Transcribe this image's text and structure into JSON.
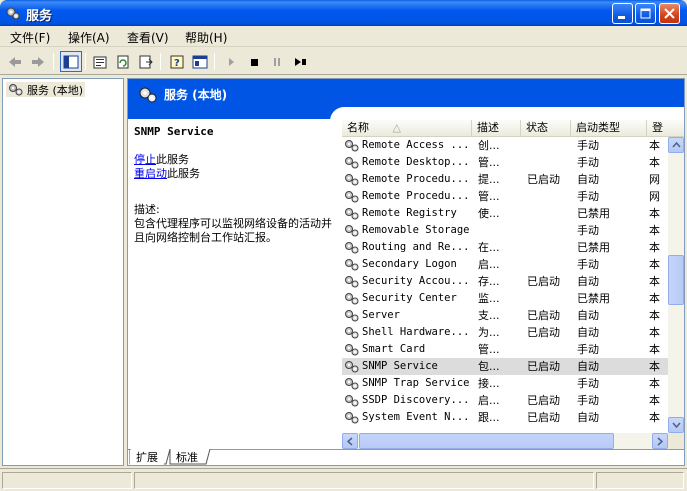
{
  "window": {
    "title": "服务",
    "icon": "gear-icon"
  },
  "menu": [
    "文件(F)",
    "操作(A)",
    "查看(V)",
    "帮助(H)"
  ],
  "toolbar": {
    "icons": [
      "back-icon",
      "forward-icon",
      "show-hide-tree-icon",
      "properties-icon",
      "refresh-icon",
      "export-list-icon",
      "help-icon",
      "console-icon",
      "start-service-icon",
      "stop-service-icon",
      "pause-service-icon",
      "restart-service-icon"
    ]
  },
  "tree": {
    "root_label": "服务 (本地)"
  },
  "pane": {
    "header_title": "服务 (本地)",
    "selected_service": "SNMP Service",
    "stop_link": "停止",
    "stop_suffix": "此服务",
    "restart_link": "重启动",
    "restart_suffix": "此服务",
    "desc_label": "描述:",
    "desc_text": "包含代理程序可以监视网络设备的活动并且向网络控制台工作站汇报。"
  },
  "list": {
    "columns": [
      "名称",
      "描述",
      "状态",
      "启动类型",
      "登"
    ],
    "rows": [
      {
        "name": "Remote Access ...",
        "desc": "创...",
        "status": "",
        "start": "手动",
        "logon": "本"
      },
      {
        "name": "Remote Desktop...",
        "desc": "管...",
        "status": "",
        "start": "手动",
        "logon": "本"
      },
      {
        "name": "Remote Procedu...",
        "desc": "提...",
        "status": "已启动",
        "start": "自动",
        "logon": "网"
      },
      {
        "name": "Remote Procedu...",
        "desc": "管...",
        "status": "",
        "start": "手动",
        "logon": "网"
      },
      {
        "name": "Remote Registry",
        "desc": "使...",
        "status": "",
        "start": "已禁用",
        "logon": "本"
      },
      {
        "name": "Removable Storage",
        "desc": "",
        "status": "",
        "start": "手动",
        "logon": "本"
      },
      {
        "name": "Routing and Re...",
        "desc": "在...",
        "status": "",
        "start": "已禁用",
        "logon": "本"
      },
      {
        "name": "Secondary Logon",
        "desc": "启...",
        "status": "",
        "start": "手动",
        "logon": "本"
      },
      {
        "name": "Security Accou...",
        "desc": "存...",
        "status": "已启动",
        "start": "自动",
        "logon": "本"
      },
      {
        "name": "Security Center",
        "desc": "监...",
        "status": "",
        "start": "已禁用",
        "logon": "本"
      },
      {
        "name": "Server",
        "desc": "支...",
        "status": "已启动",
        "start": "自动",
        "logon": "本"
      },
      {
        "name": "Shell Hardware...",
        "desc": "为...",
        "status": "已启动",
        "start": "自动",
        "logon": "本"
      },
      {
        "name": "Smart Card",
        "desc": "管...",
        "status": "",
        "start": "手动",
        "logon": "本"
      },
      {
        "name": "SNMP Service",
        "desc": "包...",
        "status": "已启动",
        "start": "自动",
        "logon": "本"
      },
      {
        "name": "SNMP Trap Service",
        "desc": "接...",
        "status": "",
        "start": "手动",
        "logon": "本"
      },
      {
        "name": "SSDP Discovery...",
        "desc": "启...",
        "status": "已启动",
        "start": "手动",
        "logon": "本"
      },
      {
        "name": "System Event N...",
        "desc": "跟...",
        "status": "已启动",
        "start": "自动",
        "logon": "本"
      }
    ],
    "selected_index": 13
  },
  "tabs": [
    "扩展",
    "标准"
  ],
  "colors": {
    "titlebar": "#0054e3",
    "header": "#0055e5",
    "link": "#0000ee",
    "selected_row": "#dcdcdc"
  }
}
